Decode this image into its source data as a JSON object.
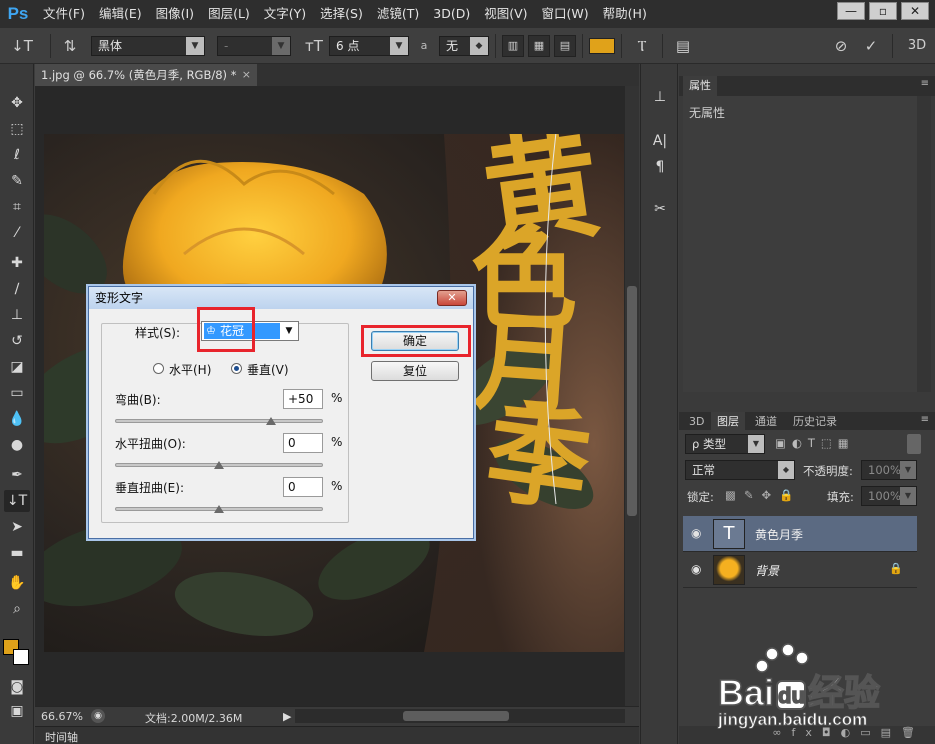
{
  "menu": {
    "logo": "Ps",
    "items": [
      "文件(F)",
      "编辑(E)",
      "图像(I)",
      "图层(L)",
      "文字(Y)",
      "选择(S)",
      "滤镜(T)",
      "3D(D)",
      "视图(V)",
      "窗口(W)",
      "帮助(H)"
    ],
    "window_controls": [
      "—",
      "▫",
      "✕"
    ]
  },
  "options": {
    "font_family": "黑体",
    "font_style": "-",
    "font_size": "6 点",
    "antialias_label": "a",
    "antialias": "无",
    "text_color": "#e0a21a"
  },
  "document": {
    "tab_title": "1.jpg @ 66.7% (黄色月季, RGB/8) *",
    "tab_close": "×",
    "warped_text": [
      "黄",
      "色",
      "月",
      "季"
    ],
    "text_color": "#dba528"
  },
  "status": {
    "zoom": "66.67%",
    "doc_info": "文档:2.00M/2.36M"
  },
  "timeline": {
    "label": "时间轴"
  },
  "dialog": {
    "title": "变形文字",
    "close": "✕",
    "style_label": "样式(S):",
    "style_value": "花冠",
    "horizontal_label": "水平(H)",
    "vertical_label": "垂直(V)",
    "orientation": "vertical",
    "bend_label": "弯曲(B):",
    "bend_value": "+50",
    "hdistort_label": "水平扭曲(O):",
    "hdistort_value": "0",
    "vdistort_label": "垂直扭曲(E):",
    "vdistort_value": "0",
    "percent": "%",
    "ok_label": "确定",
    "reset_label": "复位",
    "bend_level_pct": 75,
    "hdistort_level_pct": 50,
    "vdistort_level_pct": 50,
    "highlight_color": "#e8242c"
  },
  "properties": {
    "tab": "属性",
    "empty_text": "无属性"
  },
  "layers": {
    "tabs": [
      "3D",
      "图层",
      "通道",
      "历史记录"
    ],
    "active_tab": "图层",
    "filter_label": "ρ 类型",
    "blend_mode": "正常",
    "opacity_label": "不透明度:",
    "opacity": "100%",
    "lock_label": "锁定:",
    "fill_label": "填充:",
    "fill": "100%",
    "items": [
      {
        "name": "黄色月季",
        "type": "text",
        "thumb_glyph": "T",
        "selected": true
      },
      {
        "name": "背景",
        "type": "image",
        "locked": true,
        "selected": false
      }
    ]
  },
  "watermark": {
    "brand": "Bai",
    "brand2": "经验",
    "url": "jingyan.baidu.com"
  }
}
